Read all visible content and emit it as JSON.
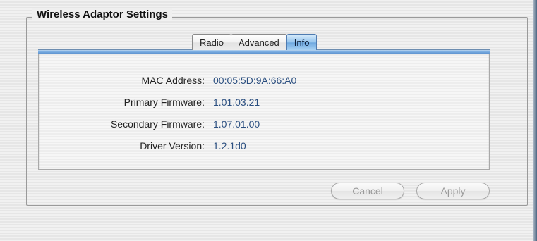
{
  "group": {
    "title": "Wireless Adaptor Settings"
  },
  "tabs": [
    {
      "label": "Radio",
      "active": false
    },
    {
      "label": "Advanced",
      "active": false
    },
    {
      "label": "Info",
      "active": true
    }
  ],
  "info": {
    "rows": [
      {
        "label": "MAC Address:",
        "value": "00:05:5D:9A:66:A0"
      },
      {
        "label": "Primary Firmware:",
        "value": "1.01.03.21"
      },
      {
        "label": "Secondary Firmware:",
        "value": "1.07.01.00"
      },
      {
        "label": "Driver Version:",
        "value": "1.2.1d0"
      }
    ]
  },
  "buttons": {
    "cancel": {
      "label": "Cancel",
      "enabled": false
    },
    "apply": {
      "label": "Apply",
      "enabled": false
    }
  },
  "colors": {
    "active_tab": "#7fb4e6",
    "value_text": "#2b4f80"
  }
}
